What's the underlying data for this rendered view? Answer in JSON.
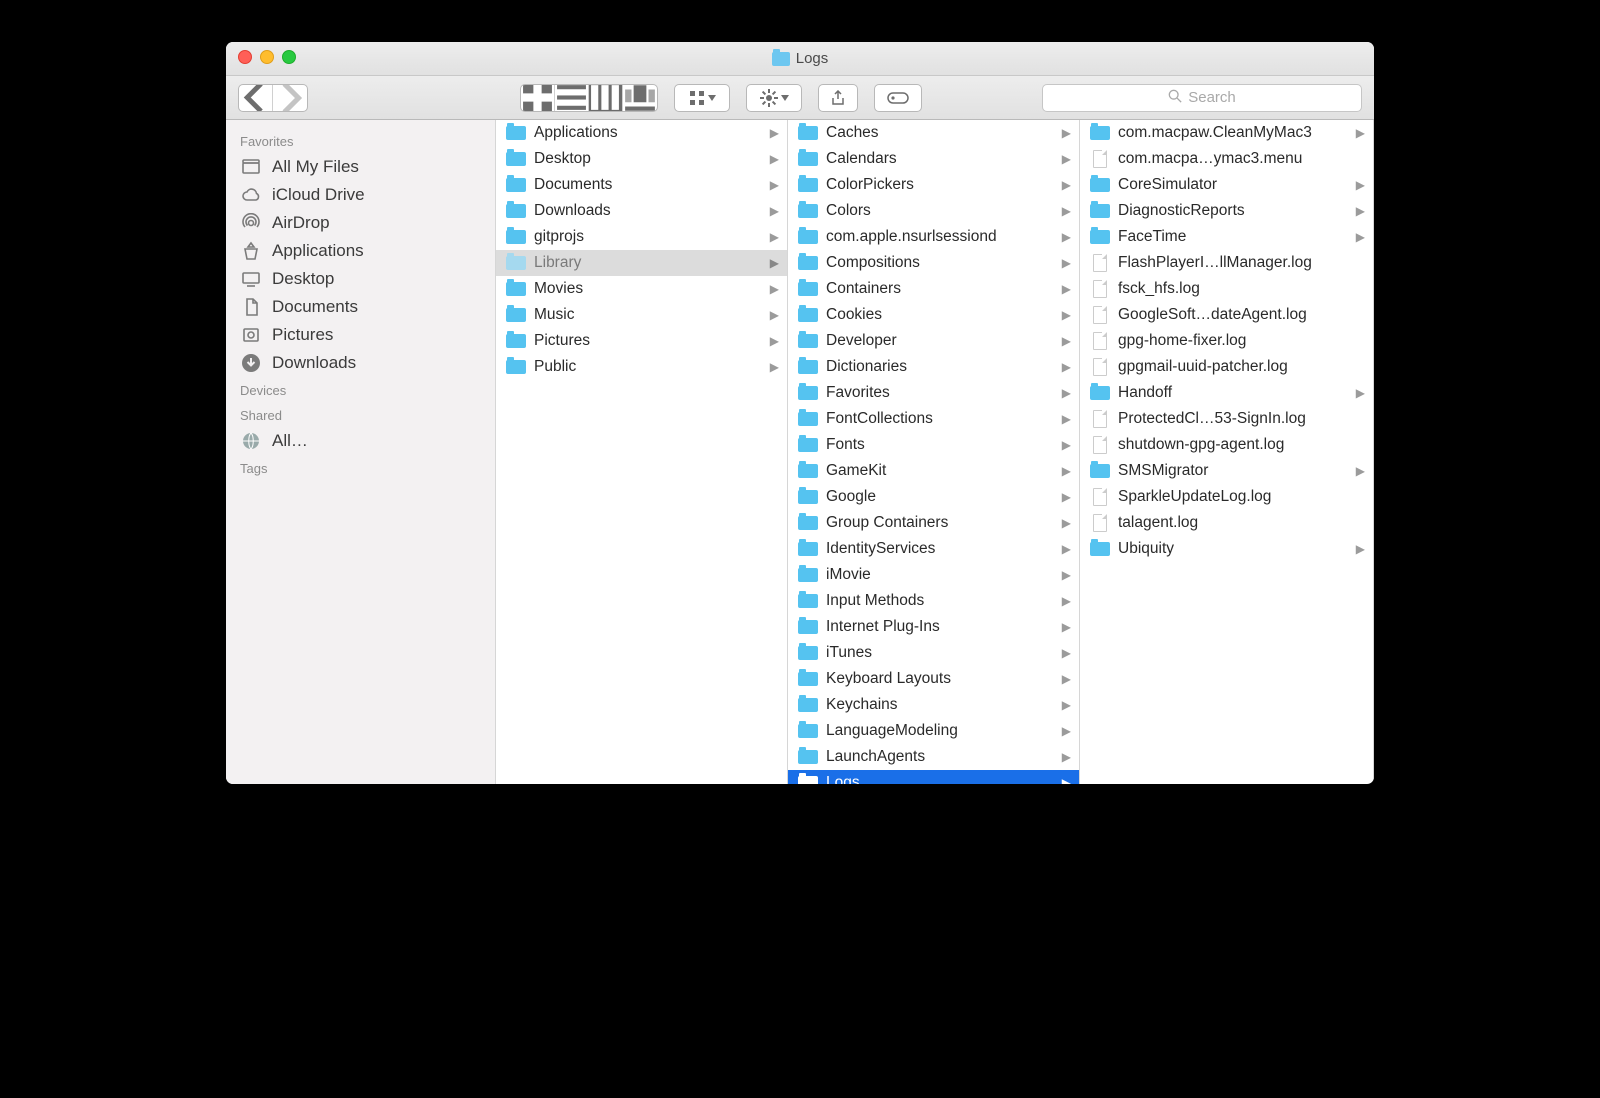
{
  "window": {
    "title": "Logs"
  },
  "search": {
    "placeholder": "Search"
  },
  "sidebar": {
    "sections": [
      {
        "title": "Favorites",
        "items": [
          {
            "label": "All My Files",
            "icon": "all-files"
          },
          {
            "label": "iCloud Drive",
            "icon": "cloud"
          },
          {
            "label": "AirDrop",
            "icon": "airdrop"
          },
          {
            "label": "Applications",
            "icon": "apps"
          },
          {
            "label": "Desktop",
            "icon": "desktop"
          },
          {
            "label": "Documents",
            "icon": "documents"
          },
          {
            "label": "Pictures",
            "icon": "pictures"
          },
          {
            "label": "Downloads",
            "icon": "downloads"
          }
        ]
      },
      {
        "title": "Devices",
        "items": []
      },
      {
        "title": "Shared",
        "items": [
          {
            "label": "All…",
            "icon": "network"
          }
        ]
      },
      {
        "title": "Tags",
        "items": []
      }
    ]
  },
  "columns": [
    [
      {
        "label": "Applications",
        "type": "folder",
        "arrow": true
      },
      {
        "label": "Desktop",
        "type": "folder",
        "arrow": true
      },
      {
        "label": "Documents",
        "type": "folder",
        "arrow": true
      },
      {
        "label": "Downloads",
        "type": "folder",
        "arrow": true
      },
      {
        "label": "gitprojs",
        "type": "folder",
        "arrow": true
      },
      {
        "label": "Library",
        "type": "folder",
        "arrow": true,
        "selected": "grey"
      },
      {
        "label": "Movies",
        "type": "folder",
        "arrow": true
      },
      {
        "label": "Music",
        "type": "folder",
        "arrow": true
      },
      {
        "label": "Pictures",
        "type": "folder",
        "arrow": true
      },
      {
        "label": "Public",
        "type": "folder",
        "arrow": true
      }
    ],
    [
      {
        "label": "Caches",
        "type": "folder",
        "arrow": true
      },
      {
        "label": "Calendars",
        "type": "folder",
        "arrow": true
      },
      {
        "label": "ColorPickers",
        "type": "folder",
        "arrow": true
      },
      {
        "label": "Colors",
        "type": "folder",
        "arrow": true
      },
      {
        "label": "com.apple.nsurlsessiond",
        "type": "folder",
        "arrow": true
      },
      {
        "label": "Compositions",
        "type": "folder",
        "arrow": true
      },
      {
        "label": "Containers",
        "type": "folder",
        "arrow": true
      },
      {
        "label": "Cookies",
        "type": "folder",
        "arrow": true
      },
      {
        "label": "Developer",
        "type": "folder",
        "arrow": true
      },
      {
        "label": "Dictionaries",
        "type": "folder",
        "arrow": true
      },
      {
        "label": "Favorites",
        "type": "folder",
        "arrow": true
      },
      {
        "label": "FontCollections",
        "type": "folder",
        "arrow": true
      },
      {
        "label": "Fonts",
        "type": "folder",
        "arrow": true
      },
      {
        "label": "GameKit",
        "type": "folder",
        "arrow": true
      },
      {
        "label": "Google",
        "type": "folder",
        "arrow": true
      },
      {
        "label": "Group Containers",
        "type": "folder",
        "arrow": true
      },
      {
        "label": "IdentityServices",
        "type": "folder",
        "arrow": true
      },
      {
        "label": "iMovie",
        "type": "folder",
        "arrow": true
      },
      {
        "label": "Input Methods",
        "type": "folder",
        "arrow": true
      },
      {
        "label": "Internet Plug-Ins",
        "type": "folder",
        "arrow": true
      },
      {
        "label": "iTunes",
        "type": "folder",
        "arrow": true
      },
      {
        "label": "Keyboard Layouts",
        "type": "folder",
        "arrow": true
      },
      {
        "label": "Keychains",
        "type": "folder",
        "arrow": true
      },
      {
        "label": "LanguageModeling",
        "type": "folder",
        "arrow": true
      },
      {
        "label": "LaunchAgents",
        "type": "folder",
        "arrow": true
      },
      {
        "label": "Logs",
        "type": "folder",
        "arrow": true,
        "selected": "blue"
      }
    ],
    [
      {
        "label": "com.macpaw.CleanMyMac3",
        "type": "folder",
        "arrow": true
      },
      {
        "label": "com.macpa…ymac3.menu",
        "type": "file"
      },
      {
        "label": "CoreSimulator",
        "type": "folder",
        "arrow": true
      },
      {
        "label": "DiagnosticReports",
        "type": "folder",
        "arrow": true
      },
      {
        "label": "FaceTime",
        "type": "folder",
        "arrow": true
      },
      {
        "label": "FlashPlayerI…llManager.log",
        "type": "file"
      },
      {
        "label": "fsck_hfs.log",
        "type": "file"
      },
      {
        "label": "GoogleSoft…dateAgent.log",
        "type": "file"
      },
      {
        "label": "gpg-home-fixer.log",
        "type": "file"
      },
      {
        "label": "gpgmail-uuid-patcher.log",
        "type": "file"
      },
      {
        "label": "Handoff",
        "type": "folder",
        "arrow": true
      },
      {
        "label": "ProtectedCl…53-SignIn.log",
        "type": "file"
      },
      {
        "label": "shutdown-gpg-agent.log",
        "type": "file"
      },
      {
        "label": "SMSMigrator",
        "type": "folder",
        "arrow": true
      },
      {
        "label": "SparkleUpdateLog.log",
        "type": "file"
      },
      {
        "label": "talagent.log",
        "type": "file"
      },
      {
        "label": "Ubiquity",
        "type": "folder",
        "arrow": true
      }
    ]
  ]
}
